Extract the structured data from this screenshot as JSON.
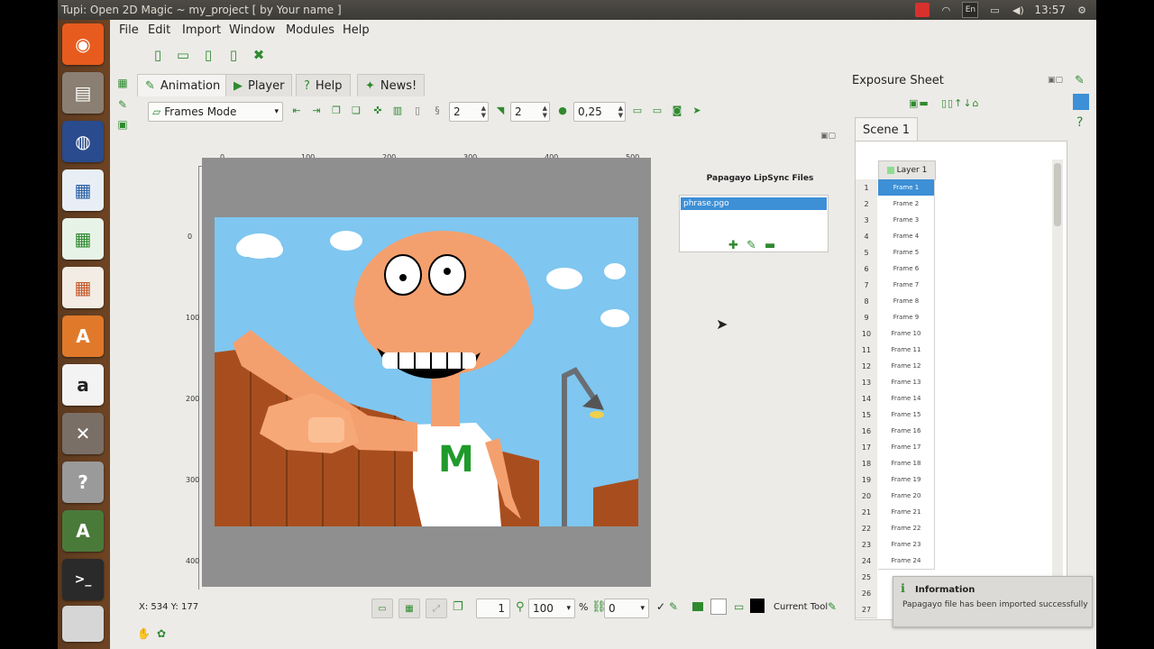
{
  "window": {
    "title": "Tupi: Open 2D Magic ~ my_project [ by Your name ]"
  },
  "panel": {
    "keyboard": "En",
    "clock": "13:57"
  },
  "menu": {
    "items": [
      "File",
      "Edit",
      "Import",
      "Window",
      "Modules",
      "Help"
    ]
  },
  "tabs": [
    {
      "label": "Animation",
      "icon": "animation-icon",
      "active": true
    },
    {
      "label": "Player",
      "icon": "play-icon",
      "active": false
    },
    {
      "label": "Help",
      "icon": "help-icon",
      "active": false
    },
    {
      "label": "News!",
      "icon": "news-icon",
      "active": false
    }
  ],
  "toolbar": {
    "mode": "Frames Mode",
    "spin1": "2",
    "spin2": "2",
    "opacity": "0,25"
  },
  "ruler": {
    "h_labels": [
      "0",
      "100",
      "200",
      "300",
      "400",
      "500"
    ],
    "v_labels": [
      "0",
      "100",
      "200",
      "300",
      "400"
    ]
  },
  "scene_drawing": {
    "shirt_letter": "M"
  },
  "lipsync": {
    "title": "Papagayo LipSync Files",
    "files": [
      "phrase.pgo"
    ]
  },
  "exposure": {
    "title": "Exposure Sheet",
    "scene_tab": "Scene 1",
    "layer": "Layer 1",
    "frames": [
      "Frame 1",
      "Frame 2",
      "Frame 3",
      "Frame 4",
      "Frame 5",
      "Frame 6",
      "Frame 7",
      "Frame 8",
      "Frame 9",
      "Frame 10",
      "Frame 11",
      "Frame 12",
      "Frame 13",
      "Frame 14",
      "Frame 15",
      "Frame 16",
      "Frame 17",
      "Frame 18",
      "Frame 19",
      "Frame 20",
      "Frame 21",
      "Frame 22",
      "Frame 23",
      "Frame 24"
    ],
    "row_numbers": [
      "1",
      "2",
      "3",
      "4",
      "5",
      "6",
      "7",
      "8",
      "9",
      "10",
      "11",
      "12",
      "13",
      "14",
      "15",
      "16",
      "17",
      "18",
      "19",
      "20",
      "21",
      "22",
      "23",
      "24",
      "25",
      "26",
      "27"
    ],
    "selected_frame": 1
  },
  "statusbar": {
    "coords": "X: 534 Y: 177",
    "frame": "1",
    "zoom": "100",
    "rotation": "0",
    "current_tool_label": "Current Tool",
    "zoom_symbol": "%"
  },
  "notification": {
    "title": "Information",
    "message": "Papagayo file has been imported successfully"
  },
  "colors": {
    "accent": "#3d8fd6",
    "icon_green": "#2f8a2f",
    "sky": "#7fc6f0",
    "skin": "#f4a06e"
  }
}
